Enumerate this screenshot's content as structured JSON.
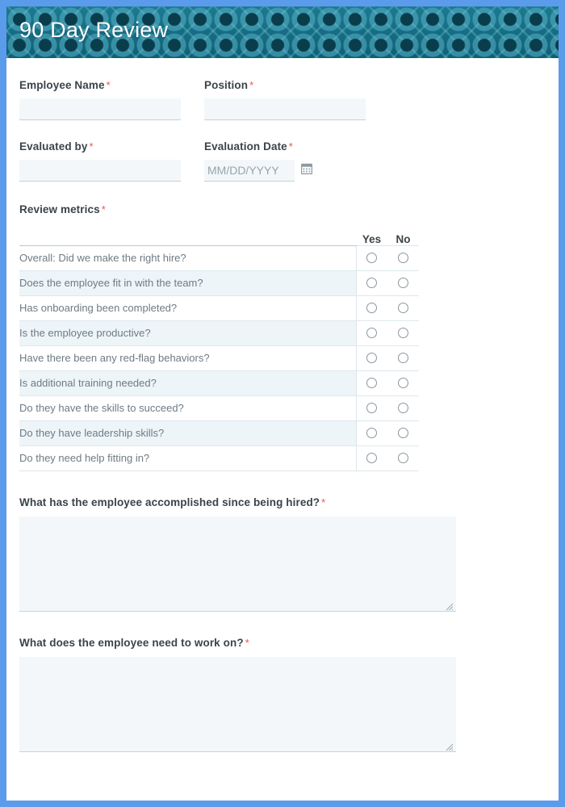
{
  "header": {
    "title": "90 Day Review",
    "background_color": "#13697e",
    "title_color": "#ffffff"
  },
  "page": {
    "border_color": "#5b9bec",
    "background_color": "#ffffff"
  },
  "theme": {
    "required_marker": "*",
    "required_color": "#e8554d",
    "label_color": "#3a4449",
    "input_fill": "#f3f7fa",
    "row_alt_fill": "#eef5f9"
  },
  "fields": {
    "employee_name": {
      "label": "Employee Name",
      "required": true,
      "value": "",
      "placeholder": ""
    },
    "position": {
      "label": "Position",
      "required": true,
      "value": "",
      "placeholder": ""
    },
    "evaluated_by": {
      "label": "Evaluated by",
      "required": true,
      "value": "",
      "placeholder": ""
    },
    "evaluation_date": {
      "label": "Evaluation Date",
      "required": true,
      "value": "",
      "placeholder": "MM/DD/YYYY",
      "icon": "calendar-icon"
    }
  },
  "metrics": {
    "label": "Review metrics",
    "required": true,
    "columns": [
      "Yes",
      "No"
    ],
    "questions": [
      "Overall: Did we make the right hire?",
      "Does the employee fit in with the team?",
      "Has onboarding been completed?",
      "Is the employee productive?",
      "Have there been any red-flag behaviors?",
      "Is additional training needed?",
      "Do they have the skills to succeed?",
      "Do they have leadership skills?",
      "Do they need help fitting in?"
    ]
  },
  "long_answers": [
    {
      "label": "What has the employee accomplished since being hired?",
      "required": true,
      "value": "",
      "placeholder": ""
    },
    {
      "label": "What does the employee need to work on?",
      "required": true,
      "value": "",
      "placeholder": ""
    }
  ]
}
